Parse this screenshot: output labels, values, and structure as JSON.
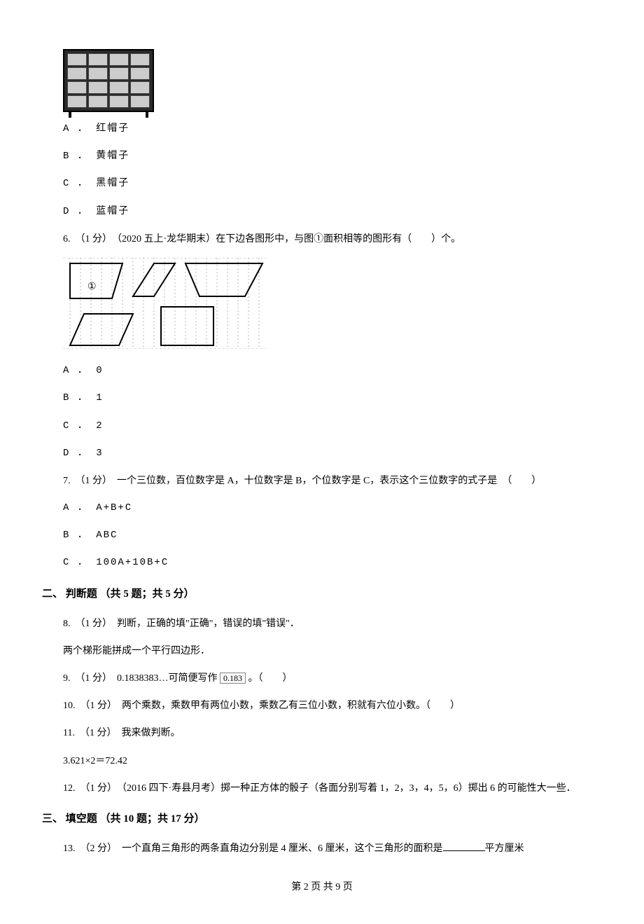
{
  "q5": {
    "optA": "A ． 红帽子",
    "optB": "B ． 黄帽子",
    "optC": "C ． 黑帽子",
    "optD": "D ． 蓝帽子"
  },
  "q6": {
    "stem": "6.　（1 分）　（2020 五上·龙华期末）在下边各图形中，与图①面积相等的图形有（　　）个。",
    "circled_label": "①",
    "optA": "A ． 0",
    "optB": "B ． 1",
    "optC": "C ． 2",
    "optD": "D ． 3"
  },
  "q7": {
    "stem": "7.　（1 分）　一个三位数，百位数字是 A，十位数字是 B，个位数字是 C，表示这个三位数字的式子是　（　　）",
    "optA": "A ． A+B+C",
    "optB": "B ． ABC",
    "optC": "C ． 100A+10B+C"
  },
  "section2": {
    "title": "二、 判断题 （共 5 题；共 5 分）"
  },
  "q8": {
    "line1": "8.　（1 分）　判断，正确的填\"正确\"，错误的填\"错误\"．",
    "line2": "两个梯形能拼成一个平行四边形．"
  },
  "q9": {
    "prefix": "9.　（1 分）　0.1838383…可简便写作 ",
    "boxed": "0.183",
    "suffix": " 。（　　）"
  },
  "q10": {
    "text": "10.　（1 分）　两个乘数，乘数甲有两位小数，乘数乙有三位小数，积就有六位小数。（　　）"
  },
  "q11": {
    "line1": "11.　（1 分）　我来做判断。",
    "line2": "3.621×2＝72.42"
  },
  "q12": {
    "text": "12.　（1 分）　（2016 四下·寿县月考）掷一种正方体的骰子（各面分别写着 1，2，3，4，5，6）掷出 6 的可能性大一些．"
  },
  "section3": {
    "title": "三、 填空题 （共 10 题；共 17 分）"
  },
  "q13": {
    "prefix": "13.　（2 分）　一个直角三角形的两条直角边分别是 4 厘米、6 厘米，这个三角形的面积是",
    "suffix": "平方厘米"
  },
  "footer": {
    "text": "第 2 页 共 9 页"
  }
}
